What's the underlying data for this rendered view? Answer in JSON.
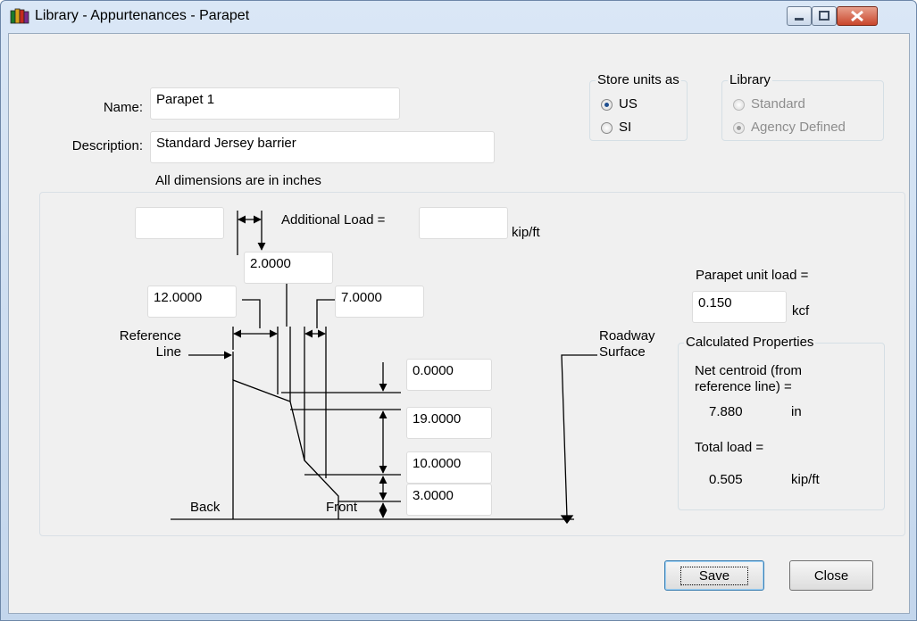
{
  "window": {
    "title": "Library - Appurtenances - Parapet",
    "icon": "books-icon"
  },
  "form": {
    "name_label": "Name:",
    "name_value": "Parapet 1",
    "description_label": "Description:",
    "description_value": "Standard Jersey barrier",
    "dimensions_note": "All dimensions are in inches"
  },
  "store_units": {
    "title": "Store units as",
    "options": [
      "US",
      "SI"
    ],
    "selected": "US"
  },
  "library": {
    "title": "Library",
    "options": [
      "Standard",
      "Agency Defined"
    ],
    "selected": "Agency Defined",
    "enabled": false
  },
  "diagram": {
    "top_offset_value": "",
    "additional_load_label": "Additional Load =",
    "additional_load_value": "",
    "additional_load_unit": "kip/ft",
    "top_width": "2.0000",
    "back_width": "12.0000",
    "front_width": "7.0000",
    "reference_line_label": "Reference\nLine",
    "reference_label_line1": "Reference",
    "reference_label_line2": "Line",
    "roadway_label_line1": "Roadway",
    "roadway_label_line2": "Surface",
    "height_1": "0.0000",
    "height_2": "19.0000",
    "height_3": "10.0000",
    "height_4": "3.0000",
    "back_label": "Back",
    "front_label": "Front",
    "unit_load_label": "Parapet unit load =",
    "unit_load_value": "0.150",
    "unit_load_unit": "kcf"
  },
  "calculated": {
    "title": "Calculated Properties",
    "centroid_label_line1": "Net centroid (from",
    "centroid_label_line2": "reference line) =",
    "centroid_value": "7.880",
    "centroid_unit": "in",
    "total_load_label": "Total load =",
    "total_load_value": "0.505",
    "total_load_unit": "kip/ft"
  },
  "buttons": {
    "save": "Save",
    "close": "Close"
  },
  "colors": {
    "title_bar": "#c8daf0",
    "client_bg": "#f0f0f0",
    "close_button": "#c9462c"
  }
}
